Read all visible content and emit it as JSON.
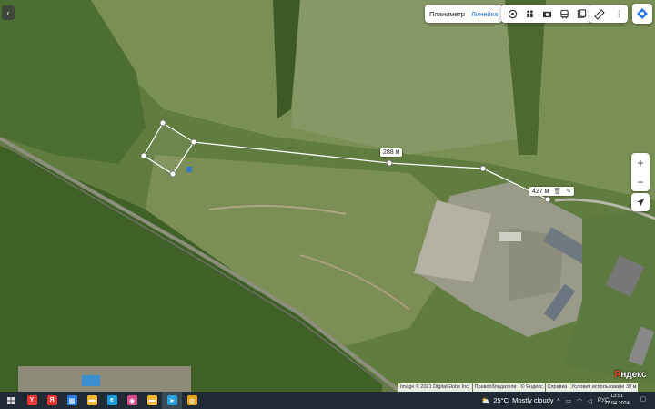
{
  "map": {
    "layers": [
      "Планиметр",
      "Линейка"
    ],
    "active_layer": "Линейка",
    "measure_labels": {
      "segment": "288 м",
      "total": "427 м"
    },
    "copyright": [
      "Image © 2021 DigitalGlobe Inc.",
      "Правообладатели",
      "© Яндекс",
      "Справка",
      "Условия использования"
    ],
    "scale": "30 м",
    "logo": "Яндекс",
    "tools": [
      "traffic-icon",
      "panorama-icon",
      "camera-icon",
      "transit-icon",
      "bookmark-icon"
    ],
    "zoom_in": "+",
    "zoom_out": "−"
  },
  "taskbar": {
    "apps": [
      {
        "name": "yandex-browser-icon",
        "glyph": "Y",
        "color": "#e33"
      },
      {
        "name": "yandex-icon",
        "glyph": "Я",
        "color": "#e33"
      },
      {
        "name": "store-icon",
        "glyph": "▦",
        "color": "#2a7de1"
      },
      {
        "name": "explorer-icon",
        "glyph": "▬",
        "color": "#f2b632"
      },
      {
        "name": "edge-icon",
        "glyph": "e",
        "color": "#1a9ad6"
      },
      {
        "name": "app-icon",
        "glyph": "◉",
        "color": "#d84c8a"
      },
      {
        "name": "files-icon",
        "glyph": "▬",
        "color": "#f2b632"
      },
      {
        "name": "telegram-icon",
        "glyph": "➤",
        "color": "#2aa3df"
      },
      {
        "name": "chrome-icon",
        "glyph": "◍",
        "color": "#e0a21b"
      }
    ],
    "weather": {
      "temp": "25°C",
      "condition": "Mostly cloudy"
    },
    "lang": "РУС",
    "time": "13:51",
    "date": "27.04.2024"
  }
}
